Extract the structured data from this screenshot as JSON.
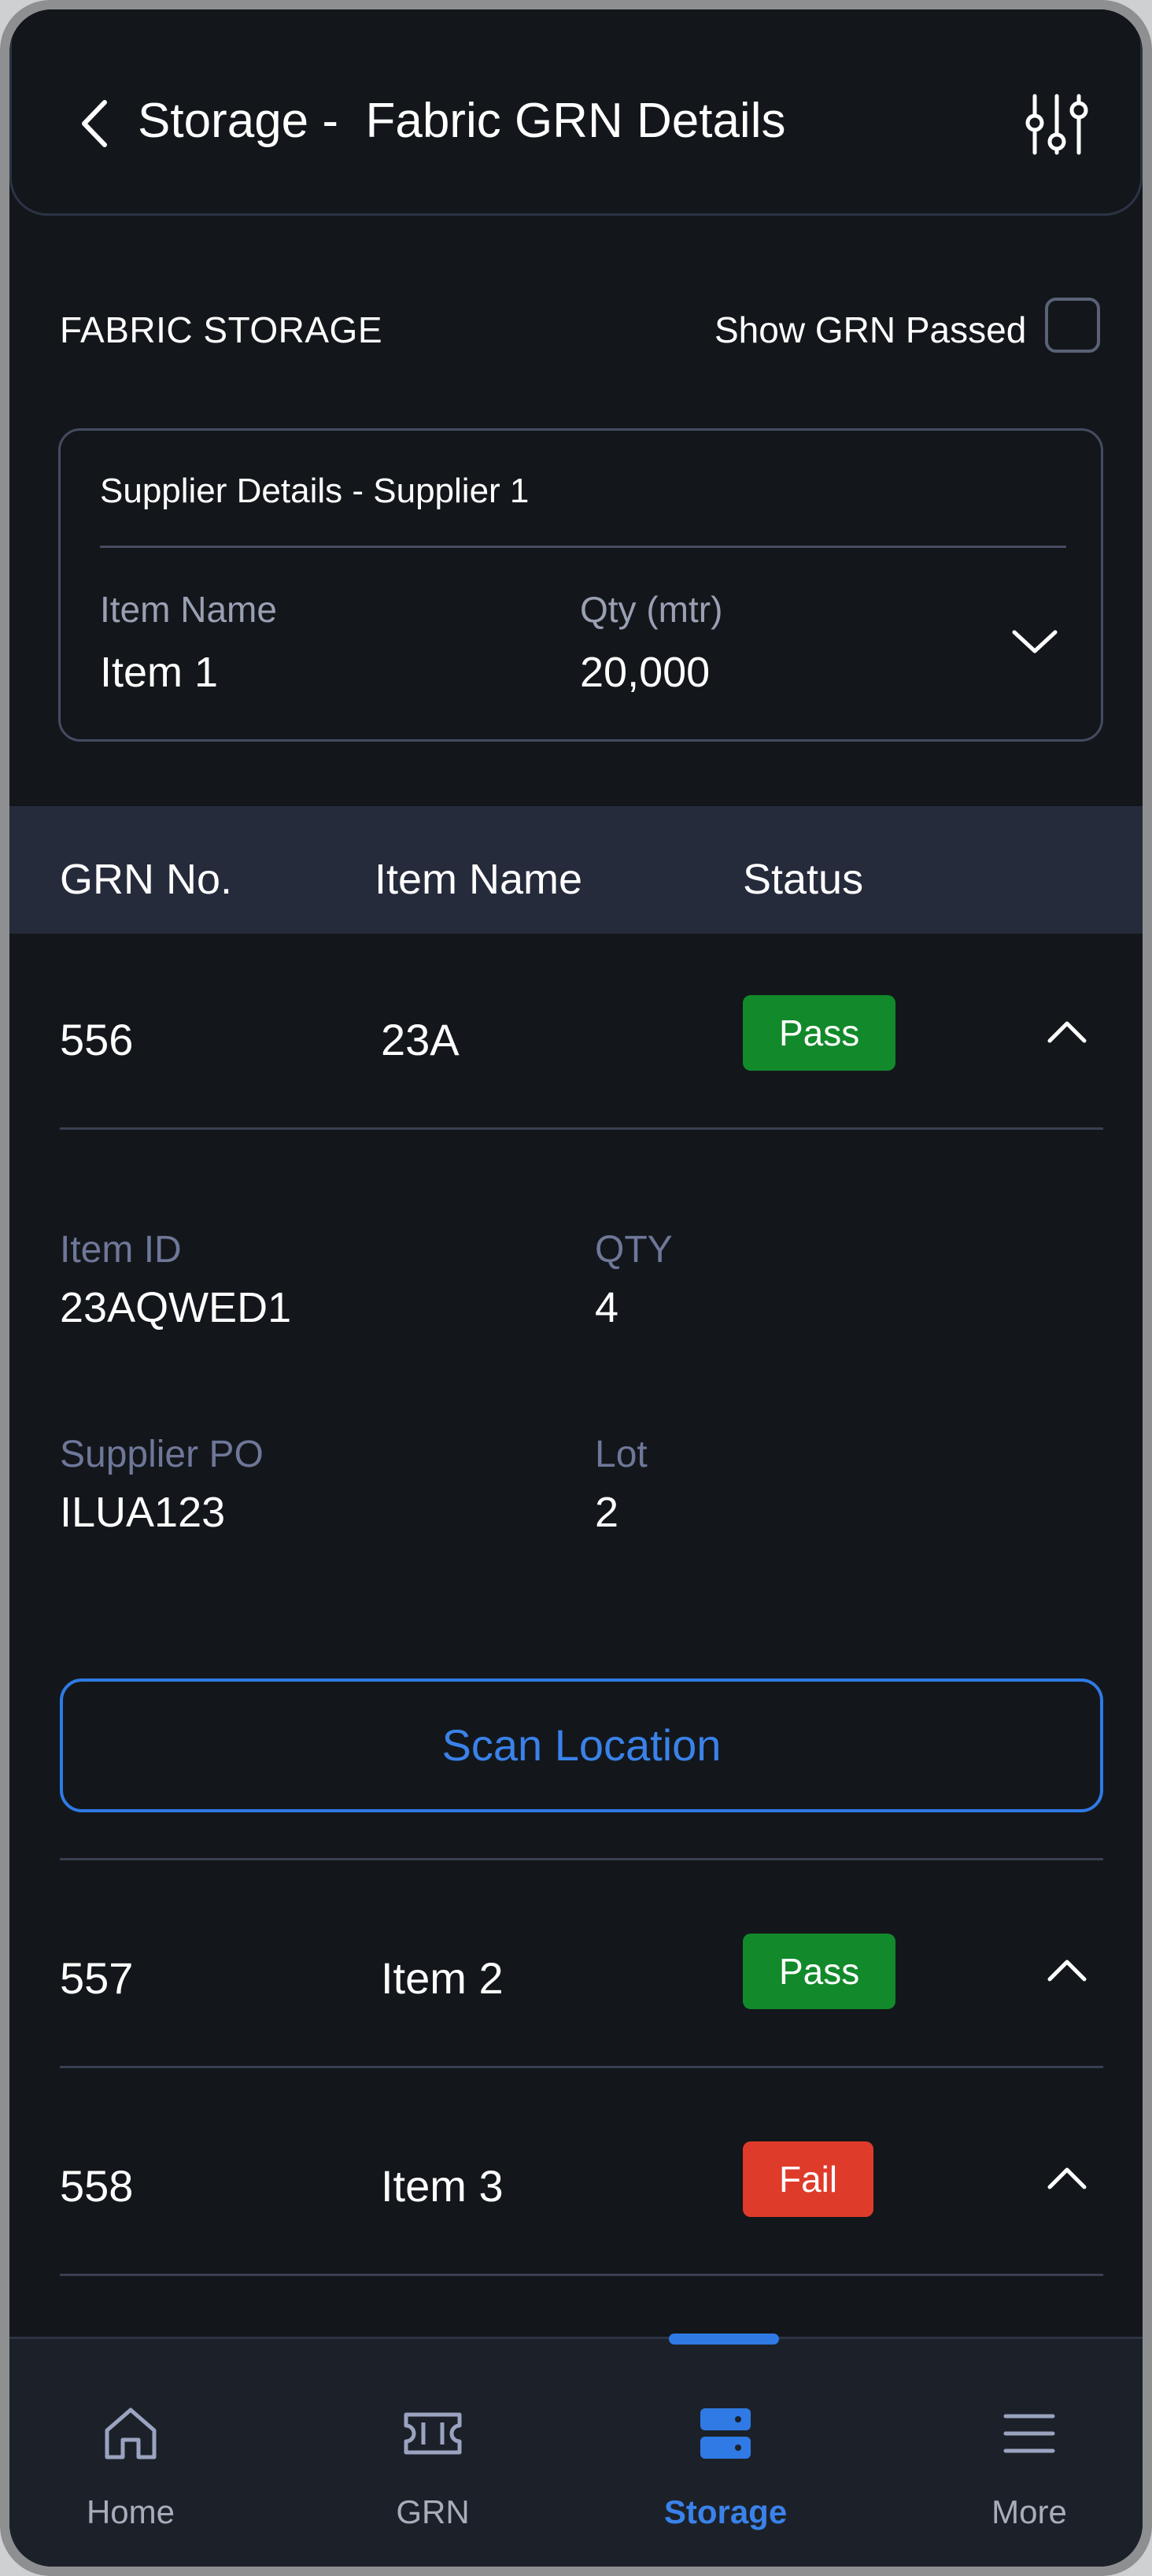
{
  "header": {
    "title": "Storage -  Fabric GRN Details"
  },
  "filter": {
    "section_label": "FABRIC STORAGE",
    "show_passed_label": "Show GRN Passed"
  },
  "supplier": {
    "title": "Supplier Details - Supplier 1",
    "item_label": "Item Name",
    "item_value": "Item 1",
    "qty_label": "Qty (mtr)",
    "qty_value": "20,000"
  },
  "table": {
    "headers": {
      "grn": "GRN No.",
      "item": "Item Name",
      "status": "Status"
    },
    "rows": [
      {
        "grn": "556",
        "item": "23A",
        "status": "Pass"
      },
      {
        "grn": "557",
        "item": "Item 2",
        "status": "Pass"
      },
      {
        "grn": "558",
        "item": "Item 3",
        "status": "Fail"
      }
    ]
  },
  "details": {
    "item_id_label": "Item ID",
    "item_id_value": "23AQWED1",
    "qty_label": "QTY",
    "qty_value": "4",
    "supplier_po_label": "Supplier PO",
    "supplier_po_value": "ILUA123",
    "lot_label": "Lot",
    "lot_value": "2"
  },
  "scan_button": {
    "label": "Scan Location"
  },
  "nav": {
    "items": [
      {
        "label": "Home",
        "icon": "home-icon"
      },
      {
        "label": "GRN",
        "icon": "ticket-icon"
      },
      {
        "label": "Storage",
        "icon": "storage-icon",
        "active": true
      },
      {
        "label": "More",
        "icon": "menu-icon"
      }
    ]
  },
  "colors": {
    "accent": "#2f7ae5",
    "pass": "#12892a",
    "fail": "#df3b2a",
    "background": "#13171b"
  }
}
